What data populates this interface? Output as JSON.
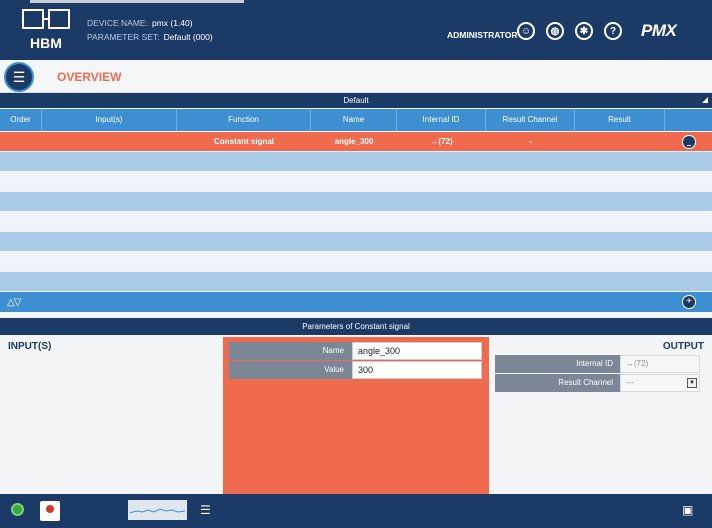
{
  "header": {
    "device_name_label": "DEVICE NAME:",
    "device_name": "pmx (1.40)",
    "parameter_set_label": "PARAMETER SET:",
    "parameter_set": "Default (000)",
    "role": "ADMINISTRATOR",
    "brand": "PMX",
    "logo_text": "HBM"
  },
  "page": {
    "title": "OVERVIEW"
  },
  "table": {
    "group_title": "Default",
    "columns": [
      "Order",
      "Input(s)",
      "Function",
      "Name",
      "Internal ID",
      "Result Channel",
      "Result"
    ],
    "selected_row": {
      "order": "",
      "inputs": "",
      "function": "Constant signal",
      "name": "angle_300",
      "internal_id": "↔(72)",
      "result_channel": "-",
      "result": ""
    }
  },
  "parameters": {
    "title": "Parameters of Constant signal",
    "inputs_heading": "INPUT(S)",
    "output_heading": "OUTPUT",
    "fields": [
      {
        "label": "Name",
        "value": "angle_300"
      },
      {
        "label": "Value",
        "value": "300"
      }
    ],
    "output_fields": [
      {
        "label": "Internal ID",
        "value": "↔(72)"
      },
      {
        "label": "Result Channel",
        "value": "---"
      }
    ]
  },
  "colors": {
    "navy": "#1c3a66",
    "blue": "#3d8fd1",
    "accent": "#f06a4e"
  }
}
